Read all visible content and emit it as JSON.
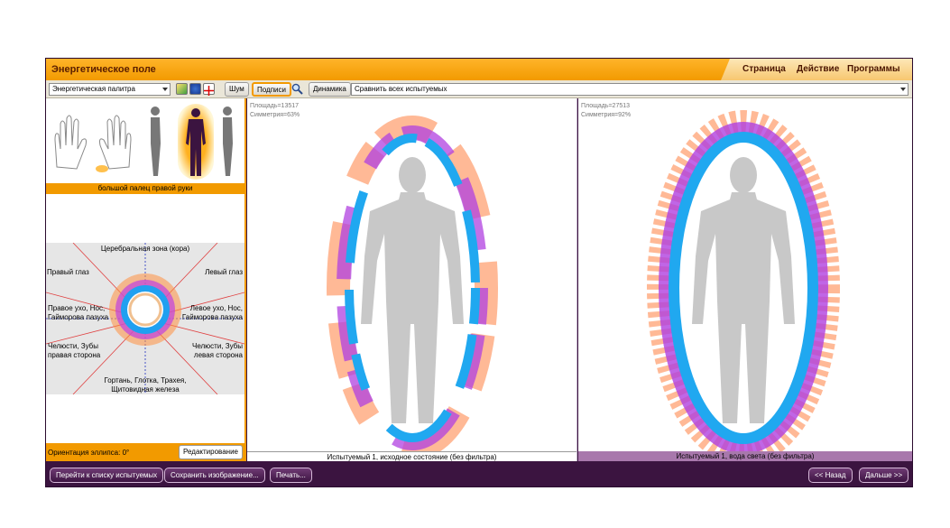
{
  "window": {
    "title": "Энергетическое поле"
  },
  "menu": [
    "Страница",
    "Действие",
    "Программы"
  ],
  "toolbar": {
    "palette": "Энергетическая палитра",
    "noise": "Шум",
    "captions": "Подписи",
    "dynamics": "Динамика",
    "compare": "Сравнить всех испытуемых"
  },
  "left": {
    "finger_label": "большой палец правой руки",
    "zones": {
      "top": "Церебральная зона (кора)",
      "right_eye": "Правый глаз",
      "left_eye": "Левый глаз",
      "right_ear": "Правое ухо, Нос,",
      "right_ear2": "Гайморова пазуха",
      "left_ear": "Левое ухо, Нос,",
      "left_ear2": "Гайморова пазуха",
      "jaw_right": "Челюсти, Зубы",
      "jaw_right2": "правая сторона",
      "jaw_left": "Челюсти, Зубы",
      "jaw_left2": "левая сторона",
      "throat": "Гортань, Глотка, Трахея,",
      "throat2": "Щитовидная железа"
    },
    "orientation": "Ориентация эллипса: 0°",
    "edit": "Редактирование"
  },
  "panels": [
    {
      "area": "Площадь=13517",
      "symmetry": "Симметрия=63%",
      "caption": "Испытуемый 1, исходное состояние (без фильтра)"
    },
    {
      "area": "Площадь=27513",
      "symmetry": "Симметрия=92%",
      "caption": "Испытуемый 1, вода света (без фильтра)"
    }
  ],
  "bottom": {
    "to_list": "Перейти к списку испытуемых",
    "save_image": "Сохранить изображение...",
    "print": "Печать...",
    "back": "<< Назад",
    "next": "Дальше >>"
  },
  "colors": {
    "accent": "#f29a00",
    "frame": "#3b1440",
    "aura_outer": "#ff7a30",
    "aura_mid": "#c040e0",
    "aura_inner": "#20a0f0"
  }
}
